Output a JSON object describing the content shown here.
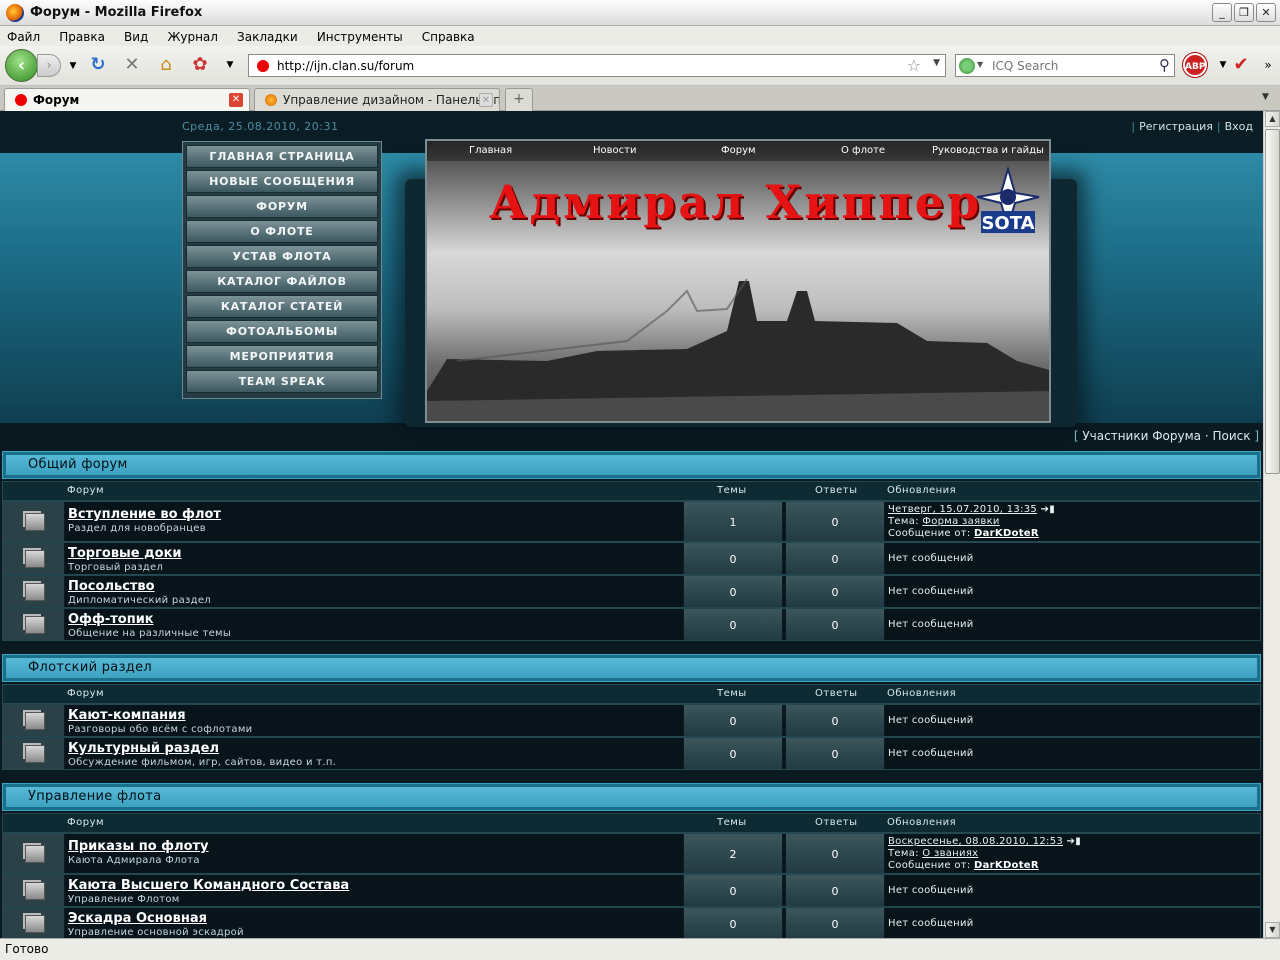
{
  "window": {
    "title": "Форум - Mozilla Firefox"
  },
  "menu": [
    "Файл",
    "Правка",
    "Вид",
    "Журнал",
    "Закладки",
    "Инструменты",
    "Справка"
  ],
  "url": "http://ijn.clan.su/forum",
  "search_placeholder": "ICQ Search",
  "abp": "ABP",
  "tabs": [
    {
      "label": "Форум"
    },
    {
      "label": "Управление дизайном - Панель упра..."
    }
  ],
  "status": "Готово",
  "site": {
    "date": "Среда, 25.08.2010, 20:31",
    "register": "Регистрация",
    "login": "Вход",
    "menu": [
      "ГЛАВНАЯ СТРАНИЦА",
      "НОВЫЕ СООБЩЕНИЯ",
      "ФОРУМ",
      "О ФЛОТЕ",
      "УСТАВ ФЛОТА",
      "КАТАЛОГ ФАЙЛОВ",
      "КАТАЛОГ СТАТЕЙ",
      "ФОТОАЛЬБОМЫ",
      "МЕРОПРИЯТИЯ",
      "TEAM SPEAK"
    ],
    "banner_nav": [
      "Главная",
      "Новости",
      "Форум",
      "О флоте",
      "Руководства и гайды"
    ],
    "banner_title": "Адмирал Хиппер",
    "logo_text": "SOTA",
    "tools": {
      "members": "Участники Форума",
      "search": "Поиск"
    }
  },
  "columns": {
    "forum": "Форум",
    "topics": "Темы",
    "replies": "Ответы",
    "updates": "Обновления"
  },
  "categories": [
    {
      "name": "Общий форум",
      "forums": [
        {
          "name": "Вступление во флот",
          "desc": "Раздел для новобранцев",
          "topics": "1",
          "replies": "0",
          "last_date": "Четверг, 15.07.2010, 13:35",
          "last_topic_label": "Тема:",
          "last_topic": "Форма заявки",
          "last_by_label": "Сообщение от:",
          "last_by": "DarKDoteR"
        },
        {
          "name": "Торговые доки",
          "desc": "Торговый раздел",
          "topics": "0",
          "replies": "0",
          "none": "Нет сообщений"
        },
        {
          "name": "Посольство",
          "desc": "Дипломатический раздел",
          "topics": "0",
          "replies": "0",
          "none": "Нет сообщений"
        },
        {
          "name": "Офф-топик",
          "desc": "Общение на различные темы",
          "topics": "0",
          "replies": "0",
          "none": "Нет сообщений"
        }
      ]
    },
    {
      "name": "Флотский раздел",
      "forums": [
        {
          "name": "Кают-компания",
          "desc": "Разговоры обо всём с софлотами",
          "topics": "0",
          "replies": "0",
          "none": "Нет сообщений"
        },
        {
          "name": "Культурный раздел",
          "desc": "Обсуждение фильмом, игр, сайтов, видео и т.п.",
          "topics": "0",
          "replies": "0",
          "none": "Нет сообщений"
        }
      ]
    },
    {
      "name": "Управление флота",
      "forums": [
        {
          "name": "Приказы по флоту",
          "desc": "Каюта Адмирала Флота",
          "topics": "2",
          "replies": "0",
          "last_date": "Воскресенье, 08.08.2010, 12:53",
          "last_topic_label": "Тема:",
          "last_topic": "О званиях",
          "last_by_label": "Сообщение от:",
          "last_by": "DarKDoteR"
        },
        {
          "name": "Каюта Высшего Командного Состава",
          "desc": "Управление Флотом",
          "topics": "0",
          "replies": "0",
          "none": "Нет сообщений"
        },
        {
          "name": "Эскадра Основная",
          "desc": "Управление основной эскадрой",
          "topics": "0",
          "replies": "0",
          "none": "Нет сообщений"
        }
      ]
    }
  ]
}
